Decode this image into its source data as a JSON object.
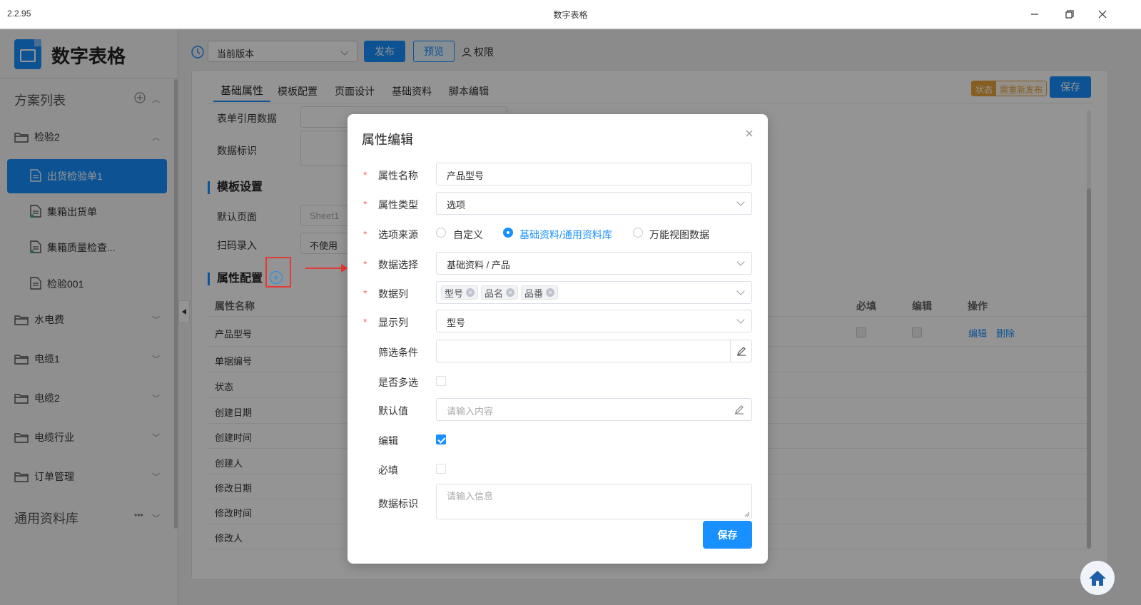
{
  "window": {
    "version": "2.2.95",
    "title": "数字表格"
  },
  "sidebar": {
    "app_title": "数字表格",
    "plan_list_label": "方案列表",
    "groups": [
      {
        "label": "检验2"
      },
      {
        "label": "水电费"
      },
      {
        "label": "电缆1"
      },
      {
        "label": "电缆2"
      },
      {
        "label": "电缆行业"
      },
      {
        "label": "订单管理"
      }
    ],
    "docs": [
      {
        "label": "出货检验单1"
      },
      {
        "label": "集箱出货单"
      },
      {
        "label": "集箱质量检查..."
      },
      {
        "label": "检验001"
      }
    ],
    "library_label": "通用资料库",
    "library_more": "•••"
  },
  "toolbar": {
    "version_select": "当前版本",
    "publish_label": "发布",
    "preview_label": "预览",
    "permission_label": "权限"
  },
  "main": {
    "tabs": [
      {
        "label": "基础属性"
      },
      {
        "label": "模板配置"
      },
      {
        "label": "页面设计"
      },
      {
        "label": "基础资料"
      },
      {
        "label": "脚本编辑"
      }
    ],
    "status_key": "状态",
    "status_value": "需重新发布",
    "save_label": "保存",
    "form": {
      "ref_data_label": "表单引用数据",
      "data_id_label": "数据标识",
      "template_section": "模板设置",
      "default_page_label": "默认页面",
      "default_page_value": "Sheet1",
      "scan_label": "扫码录入",
      "scan_value": "不使用",
      "attr_section": "属性配置"
    },
    "table": {
      "headers": {
        "name": "属性名称",
        "required": "必填",
        "edit": "编辑",
        "ops": "操作"
      },
      "rows": [
        "产品型号",
        "单据编号",
        "状态",
        "创建日期",
        "创建时间",
        "创建人",
        "修改日期",
        "修改时间",
        "修改人"
      ],
      "edit_link": "编辑",
      "delete_link": "删除"
    }
  },
  "modal": {
    "title": "属性编辑",
    "fields": {
      "name_label": "属性名称",
      "name_value": "产品型号",
      "type_label": "属性类型",
      "type_value": "选项",
      "source_label": "选项来源",
      "source_options": [
        "自定义",
        "基础资料/通用资料库",
        "万能视图数据"
      ],
      "data_select_label": "数据选择",
      "data_select_value": "基础资料 / 产品",
      "data_cols_label": "数据列",
      "data_cols_tags": [
        "型号",
        "品名",
        "品番"
      ],
      "display_col_label": "显示列",
      "display_col_value": "型号",
      "filter_label": "筛选条件",
      "multi_label": "是否多选",
      "default_label": "默认值",
      "default_placeholder": "请输入内容",
      "edit_label": "编辑",
      "required_label": "必填",
      "data_id_label": "数据标识",
      "data_id_placeholder": "请输入信息"
    },
    "save_label": "保存"
  },
  "colors": {
    "primary": "#1890ff",
    "warning": "#e6a23c",
    "danger": "#f56c6c",
    "annotation": "#e53935"
  }
}
